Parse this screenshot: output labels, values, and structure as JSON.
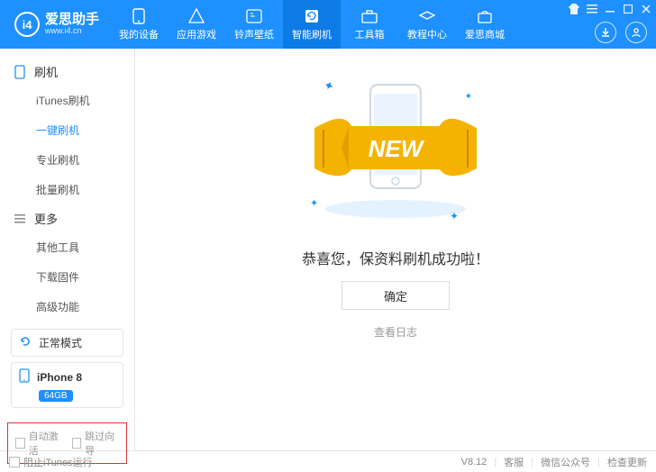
{
  "brand": {
    "name": "爱思助手",
    "url": "www.i4.cn",
    "logo_text": "i4"
  },
  "nav": [
    {
      "id": "devices",
      "label": "我的设备"
    },
    {
      "id": "apps",
      "label": "应用游戏"
    },
    {
      "id": "ringtones",
      "label": "铃声壁纸"
    },
    {
      "id": "flash",
      "label": "智能刷机",
      "active": true
    },
    {
      "id": "toolbox",
      "label": "工具箱"
    },
    {
      "id": "tutorial",
      "label": "教程中心"
    },
    {
      "id": "mall",
      "label": "爱思商城"
    }
  ],
  "sidebar": {
    "groups": [
      {
        "id": "flash",
        "title": "刷机",
        "items": [
          {
            "id": "itunes-flash",
            "label": "iTunes刷机"
          },
          {
            "id": "oneclick-flash",
            "label": "一键刷机",
            "active": true
          },
          {
            "id": "pro-flash",
            "label": "专业刷机"
          },
          {
            "id": "batch-flash",
            "label": "批量刷机"
          }
        ]
      },
      {
        "id": "more",
        "title": "更多",
        "items": [
          {
            "id": "other-tools",
            "label": "其他工具"
          },
          {
            "id": "download-fw",
            "label": "下载固件"
          },
          {
            "id": "advanced",
            "label": "高级功能"
          }
        ]
      }
    ],
    "status_mode": "正常模式",
    "device_name": "iPhone 8",
    "device_badge": "64GB",
    "auto_activate": "自动激活",
    "skip_wizard": "跳过向导"
  },
  "content": {
    "new_banner": "NEW",
    "success_text": "恭喜您，保资料刷机成功啦！",
    "ok_button": "确定",
    "view_log": "查看日志"
  },
  "footer": {
    "block_itunes": "阻止iTunes运行",
    "version": "V8.12",
    "support": "客服",
    "wechat": "微信公众号",
    "check_update": "检查更新"
  }
}
